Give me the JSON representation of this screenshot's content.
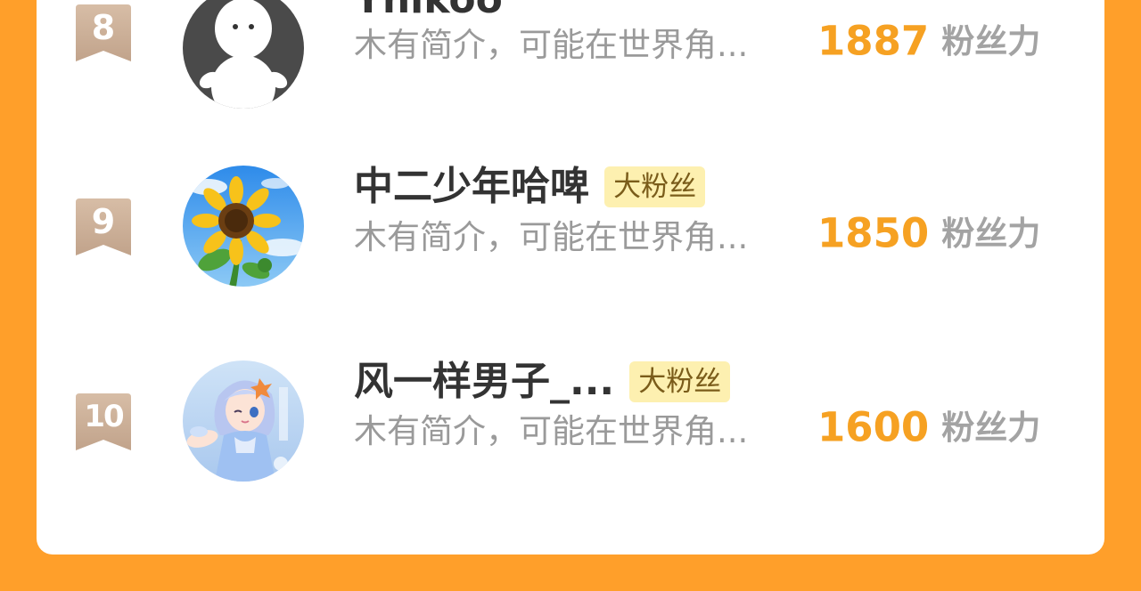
{
  "ranking": {
    "rows": [
      {
        "rank": "8",
        "name": "Ynikoo",
        "badge": "",
        "intro": "木有简介，可能在世界角...",
        "score": "1887",
        "score_unit": "粉丝力",
        "avatar_icon": "default-person-avatar"
      },
      {
        "rank": "9",
        "name": "中二少年哈啤",
        "badge": "大粉丝",
        "intro": "木有简介，可能在世界角...",
        "score": "1850",
        "score_unit": "粉丝力",
        "avatar_icon": "sunflower-avatar"
      },
      {
        "rank": "10",
        "name": "风一样男子_...",
        "badge": "大粉丝",
        "intro": "木有简介，可能在世界角...",
        "score": "1600",
        "score_unit": "粉丝力",
        "avatar_icon": "anime-girl-avatar"
      }
    ]
  },
  "colors": {
    "page_background": "#FF9F2A",
    "score": "#F6A122",
    "badge_background": "#FDF0B0",
    "rank_ribbon": "#CBB09A"
  }
}
